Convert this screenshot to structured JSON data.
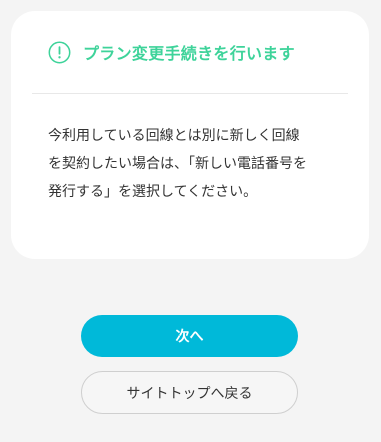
{
  "colors": {
    "accent": "#3ed39a",
    "primary_button": "#00b9d9",
    "background": "#f4f4f4",
    "card": "#ffffff",
    "text": "#333333"
  },
  "card": {
    "icon": "info-circle-icon",
    "title": "プラン変更手続きを行います",
    "body_lines": [
      "今利用している回線とは別に新しく回線",
      "を契約したい場合は、「新しい電話番号を",
      "発行する」を選択してください。"
    ]
  },
  "actions": {
    "next_label": "次へ",
    "back_to_top_label": "サイトトップへ戻る"
  }
}
